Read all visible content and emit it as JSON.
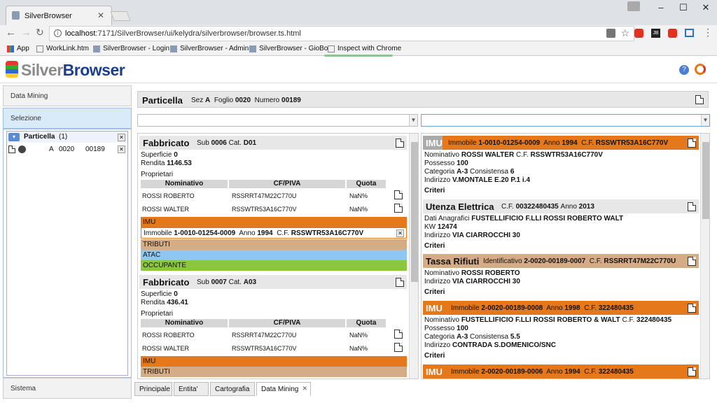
{
  "browser": {
    "tab_title": "SilverBrowser",
    "url_host": "localhost",
    "url_rest": ":7171/SilverBrowser/ui/kelydra/silverbrowser/browser.ts.html",
    "bookmarks": [
      "App",
      "WorkLink.htm",
      "SilverBrowser - Login",
      "SilverBrowser - Admin",
      "SilverBrowser - GioBo",
      "Inspect with Chrome"
    ]
  },
  "app": {
    "logo_silver": "Silver",
    "logo_browser": "Browser"
  },
  "left": {
    "data_mining": "Data Mining",
    "selezione": "Selezione",
    "sistema": "Sistema",
    "tree_root": "Particella",
    "tree_count": "(1)",
    "tree_item": {
      "sez": "A",
      "foglio": "0020",
      "numero": "00189"
    }
  },
  "header": {
    "title": "Particella",
    "sez_label": "Sez",
    "sez": "A",
    "foglio_label": "Foglio",
    "foglio": "0020",
    "numero_label": "Numero",
    "numero": "00189"
  },
  "fabbricati": [
    {
      "title": "Fabbricato",
      "sub_label": "Sub",
      "sub": "0006",
      "cat_label": "Cat.",
      "cat": "D01",
      "superficie_label": "Superficie",
      "superficie": "0",
      "rendita_label": "Rendita",
      "rendita": "1146.53",
      "proprietari_label": "Proprietari",
      "cols": [
        "Nominativo",
        "CF/PIVA",
        "Quota"
      ],
      "rows": [
        [
          "ROSSI ROBERTO",
          "RSSRRT47M22C770U",
          "NaN%"
        ],
        [
          "ROSSI WALTER",
          "RSSWTR53A16C770V",
          "NaN%"
        ]
      ],
      "imu": "IMU",
      "imu_detail": {
        "immobile_label": "Immobile",
        "immobile": "1-0010-01254-0009",
        "anno_label": "Anno",
        "anno": "1994",
        "cf_label": "C.F.",
        "cf": "RSSWTR53A16C770V"
      },
      "tributi": "TRIBUTI",
      "atac": "ATAC",
      "occupante": "OCCUPANTE"
    },
    {
      "title": "Fabbricato",
      "sub_label": "Sub",
      "sub": "0007",
      "cat_label": "Cat.",
      "cat": "A03",
      "superficie_label": "Superficie",
      "superficie": "0",
      "rendita_label": "Rendita",
      "rendita": "436.41",
      "proprietari_label": "Proprietari",
      "cols": [
        "Nominativo",
        "CF/PIVA",
        "Quota"
      ],
      "rows": [
        [
          "ROSSI ROBERTO",
          "RSSRRT47M22C770U",
          "NaN%"
        ],
        [
          "ROSSI WALTER",
          "RSSWTR53A16C770V",
          "NaN%"
        ]
      ],
      "imu": "IMU",
      "tributi": "TRIBUTI"
    }
  ],
  "right": {
    "imu1": {
      "title": "IMU",
      "immobile_label": "Immobile",
      "immobile": "1-0010-01254-0009",
      "anno_label": "Anno",
      "anno": "1994",
      "cf_label": "C.F.",
      "cf": "RSSWTR53A16C770V",
      "nominativo_label": "Nominativo",
      "nominativo": "ROSSI WALTER",
      "cf2_label": "C.F.",
      "cf2": "RSSWTR53A16C770V",
      "possesso_label": "Possesso",
      "possesso": "100",
      "categoria_label": "Categoria",
      "categoria": "A-3",
      "consistensa_label": "Consistensa",
      "consistensa": "6",
      "indirizzo_label": "Indirizzo",
      "indirizzo": "V.MONTALE E.20 P.1 i.4",
      "criteri": "Criteri"
    },
    "utenza": {
      "title": "Utenza Elettrica",
      "cf_label": "C.F.",
      "cf": "00322480435",
      "anno_label": "Anno",
      "anno": "2013",
      "dati_label": "Dati Anagrafici",
      "dati": "FUSTELLIFICIO F.LLI ROSSI ROBERTO WALT",
      "kw_label": "KW",
      "kw": "12474",
      "indirizzo_label": "Indirizzo",
      "indirizzo": "VIA CIARROCCHI 30",
      "criteri": "Criteri"
    },
    "tassa": {
      "title": "Tassa Rifiuti",
      "id_label": "Identificativo",
      "id": "2-0020-00189-0007",
      "cf_label": "C.F.",
      "cf": "RSSRRT47M22C770U",
      "nominativo_label": "Nominativo",
      "nominativo": "ROSSI ROBERTO",
      "indirizzo_label": "Indirizzo",
      "indirizzo": "VIA CIARROCCHI 30",
      "criteri": "Criteri"
    },
    "imu2": {
      "title": "IMU",
      "immobile_label": "Immobile",
      "immobile": "2-0020-00189-0008",
      "anno_label": "Anno",
      "anno": "1998",
      "cf_label": "C.F.",
      "cf": "322480435",
      "nominativo_label": "Nominativo",
      "nominativo": "FUSTELLIFICIO F.LLI ROSSI ROBERTO & WALT",
      "cf2_label": "C.F.",
      "cf2": "322480435",
      "possesso_label": "Possesso",
      "possesso": "100",
      "categoria_label": "Categoria",
      "categoria": "A-3",
      "consistensa_label": "Consistensa",
      "consistensa": "5.5",
      "indirizzo_label": "Indirizzo",
      "indirizzo": "CONTRADA S.DOMENICO/SNC",
      "criteri": "Criteri"
    },
    "imu3": {
      "title": "IMU",
      "immobile_label": "Immobile",
      "immobile": "2-0020-00189-0006",
      "anno_label": "Anno",
      "anno": "1994",
      "cf_label": "C.F.",
      "cf": "322480435"
    }
  },
  "bottom_tabs": [
    "Principale",
    "Entita'",
    "Cartografia",
    "Data Mining"
  ],
  "colors": {
    "imu": "#e5781a",
    "tributi": "#d4ad86",
    "atac": "#8ec8f2",
    "occupante": "#8cc63f"
  }
}
